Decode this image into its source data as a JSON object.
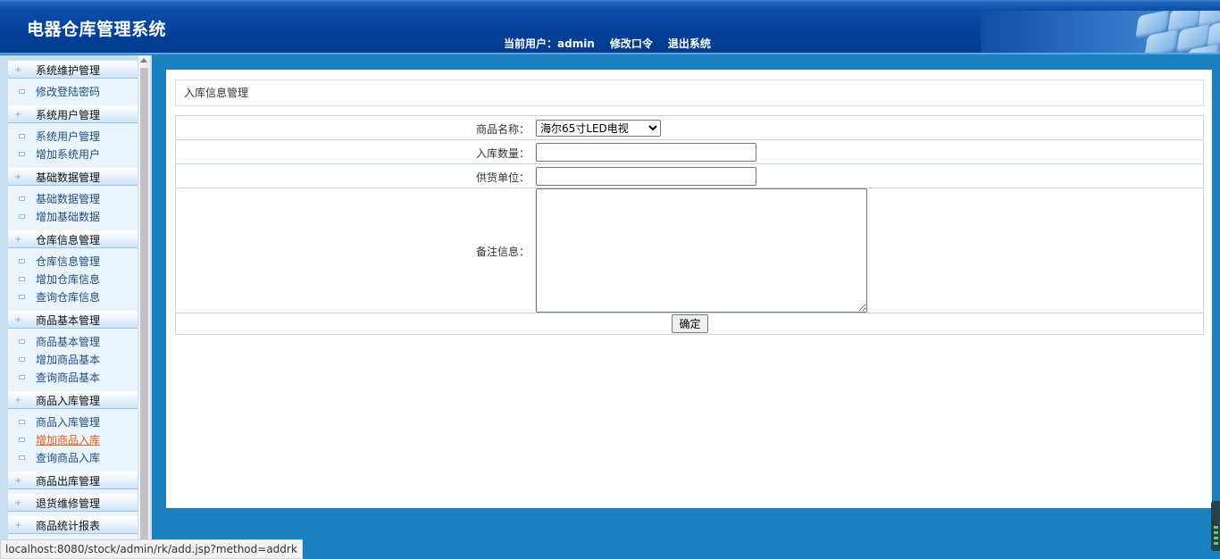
{
  "header": {
    "app_title": "电器仓库管理系统",
    "current_user_label": "当前用户：admin",
    "change_password": "修改口令",
    "logout": "退出系统"
  },
  "sidebar": {
    "groups": [
      {
        "title": "系统维护管理",
        "items": [
          "修改登陆密码"
        ]
      },
      {
        "title": "系统用户管理",
        "items": [
          "系统用户管理",
          "增加系统用户"
        ]
      },
      {
        "title": "基础数据管理",
        "items": [
          "基础数据管理",
          "增加基础数据"
        ]
      },
      {
        "title": "仓库信息管理",
        "items": [
          "仓库信息管理",
          "增加仓库信息",
          "查询仓库信息"
        ]
      },
      {
        "title": "商品基本管理",
        "items": [
          "商品基本管理",
          "增加商品基本",
          "查询商品基本"
        ]
      },
      {
        "title": "商品入库管理",
        "items": [
          "商品入库管理",
          "增加商品入库",
          "查询商品入库"
        ]
      },
      {
        "title": "商品出库管理",
        "items": []
      },
      {
        "title": "退货维修管理",
        "items": []
      },
      {
        "title": "商品统计报表",
        "items": []
      }
    ],
    "active_item": "增加商品入库"
  },
  "page": {
    "header_title": "入库信息管理",
    "form": {
      "product_label": "商品名称：",
      "product_selected": "海尔65寸LED电视",
      "quantity_label": "入库数量：",
      "quantity_value": "",
      "supplier_label": "供货单位：",
      "supplier_value": "",
      "remark_label": "备注信息：",
      "remark_value": "",
      "confirm_label": "确定"
    }
  },
  "status_bar": {
    "url": "localhost:8080/stock/admin/rk/add.jsp?method=addrk"
  }
}
